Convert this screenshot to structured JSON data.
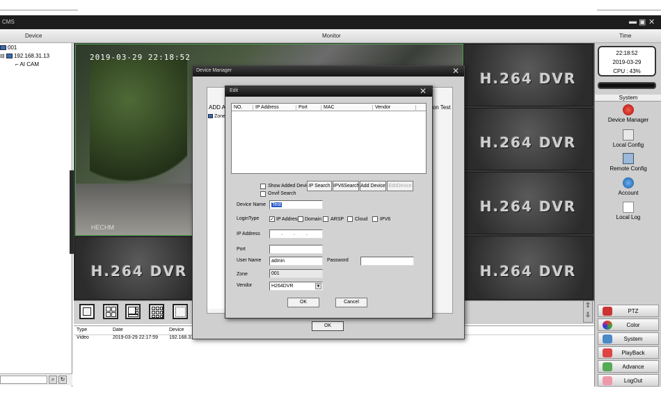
{
  "window": {
    "title": "CMS"
  },
  "header": {
    "device": "Device",
    "monitor": "Monitor",
    "time": "Time"
  },
  "tree": {
    "zone": "001",
    "ip": "192.168.31.13",
    "cam": "AI CAM"
  },
  "camera": {
    "timestamp": "2019-03-29 22:18:52",
    "watermark": "HECHM"
  },
  "tiles": {
    "label": "H.264 DVR"
  },
  "clock": {
    "time": "22:18:52",
    "date": "2019-03-29",
    "cpu": "CPU : 43%"
  },
  "right": {
    "system_header": "System",
    "links": [
      "Device Manager",
      "Local Config",
      "Remote Config",
      "Account",
      "Local Log"
    ],
    "nav": [
      "PTZ",
      "Color",
      "System",
      "PlayBack",
      "Advance",
      "LogOut"
    ]
  },
  "log": {
    "headers": [
      "Type",
      "Date",
      "Device"
    ],
    "rows": [
      {
        "type": "Video",
        "date": "2019-03-29 22:17:59",
        "device": "192.168.31.13"
      }
    ]
  },
  "device_manager": {
    "title": "Device Manager",
    "tab_left": "ADD AR",
    "tab_right": "ion Test",
    "tree_zone": "Zone",
    "ok": "OK"
  },
  "edit": {
    "title": "Edit",
    "columns": [
      "NO.",
      "IP Address",
      "Port",
      "MAC",
      "Vendor"
    ],
    "show_added": "Show Added Devic",
    "onvif": "Onvif Search",
    "buttons": {
      "ip_search": "IP Search",
      "ipv6_search": "IPV6Search",
      "add_device": "Add Device",
      "edit_device": "EditDevice"
    },
    "device_name_label": "Device Name",
    "device_name": "Test",
    "login_type_label": "LoginType",
    "login_types": [
      "IP Address",
      "Domain",
      "ARSP",
      "Cloud",
      "IPV6"
    ],
    "ip_label": "IP Address",
    "ip_value": ". . .",
    "port_label": "Port",
    "port_value": "",
    "user_label": "User Name",
    "user_value": "admin",
    "password_label": "Password",
    "password_value": "",
    "zone_label": "Zone",
    "zone_value": "001",
    "vendor_label": "Vendor",
    "vendor_value": "H264DVR",
    "ok": "OK",
    "cancel": "Cancel"
  }
}
